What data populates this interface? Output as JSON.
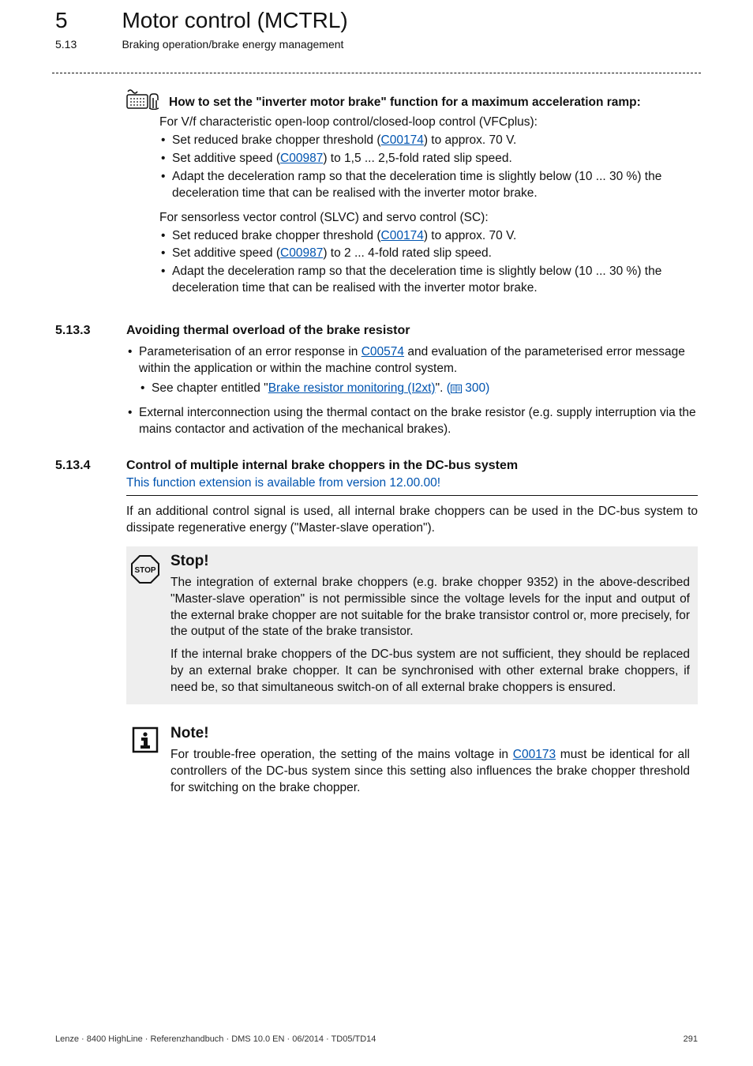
{
  "header": {
    "chapter_num": "5",
    "chapter_title": "Motor control (MCTRL)",
    "section_num": "5.13",
    "section_title": "Braking operation/brake energy management"
  },
  "howto": {
    "title": "How to set the \"inverter motor brake\" function for a maximum acceleration ramp:",
    "vfc_intro": "For V/f characteristic open-loop control/closed-loop control (VFCplus):",
    "vfc_b1_pre": "Set reduced brake chopper threshold (",
    "vfc_b1_link": "C00174",
    "vfc_b1_post": ") to approx. 70 V.",
    "vfc_b2_pre": "Set additive speed (",
    "vfc_b2_link": "C00987",
    "vfc_b2_post": ") to 1,5 ... 2,5-fold rated slip speed.",
    "vfc_b3": "Adapt the deceleration ramp so that the deceleration time is slightly below (10 ... 30 %) the deceleration time that can be realised with the inverter motor brake.",
    "slvc_intro": "For sensorless vector control (SLVC) and servo control (SC):",
    "slvc_b1_pre": "Set reduced brake chopper threshold (",
    "slvc_b1_link": "C00174",
    "slvc_b1_post": ") to approx. 70 V.",
    "slvc_b2_pre": "Set additive speed (",
    "slvc_b2_link": "C00987",
    "slvc_b2_post": ") to 2 ... 4-fold rated slip speed.",
    "slvc_b3": "Adapt the deceleration ramp so that the deceleration time is slightly below (10 ... 30 %) the deceleration time that can be realised with the inverter motor brake."
  },
  "s5133": {
    "num": "5.13.3",
    "title": "Avoiding thermal overload of the brake resistor",
    "b1_pre": "Parameterisation of an error response in ",
    "b1_link": "C00574",
    "b1_post": " and evaluation of the parameterised error message within the application or within the machine control system.",
    "b1a_pre": "See chapter entitled \"",
    "b1a_link": "Brake resistor monitoring (I2xt)",
    "b1a_post": "\". ",
    "b1a_ref": "300)",
    "b2": "External interconnection using the thermal contact on the brake resistor (e.g. supply interruption via the mains contactor and activation of the mechanical brakes)."
  },
  "s5134": {
    "num": "5.13.4",
    "title": "Control of multiple internal brake choppers in the DC-bus system",
    "blue": "This function extension is available from version 12.00.00!",
    "intro": "If an additional control signal is used, all internal brake choppers can be used in the DC-bus system to dissipate regenerative energy (\"Master-slave operation\").",
    "stop_title": "Stop!",
    "stop_p1": "The integration of external brake choppers (e.g. brake chopper 9352) in the above-described \"Master-slave operation\" is not permissible since the voltage levels for the input and output of the external brake chopper are not suitable for the brake transistor control or, more precisely, for the output of the state of the brake transistor.",
    "stop_p2": "If the internal brake choppers of the DC-bus system are not sufficient, they should be replaced by an external brake chopper. It can be synchronised with other external brake choppers, if need be, so that simultaneous switch-on of all external brake choppers is ensured.",
    "note_title": "Note!",
    "note_p_pre": "For trouble-free operation, the setting of the mains voltage in ",
    "note_p_link": "C00173",
    "note_p_post": " must be identical for all controllers of the DC-bus system since this setting also influences the brake chopper threshold for switching on the brake chopper."
  },
  "footer": {
    "left": "Lenze · 8400 HighLine · Referenzhandbuch · DMS 10.0 EN · 06/2014 · TD05/TD14",
    "right": "291"
  }
}
